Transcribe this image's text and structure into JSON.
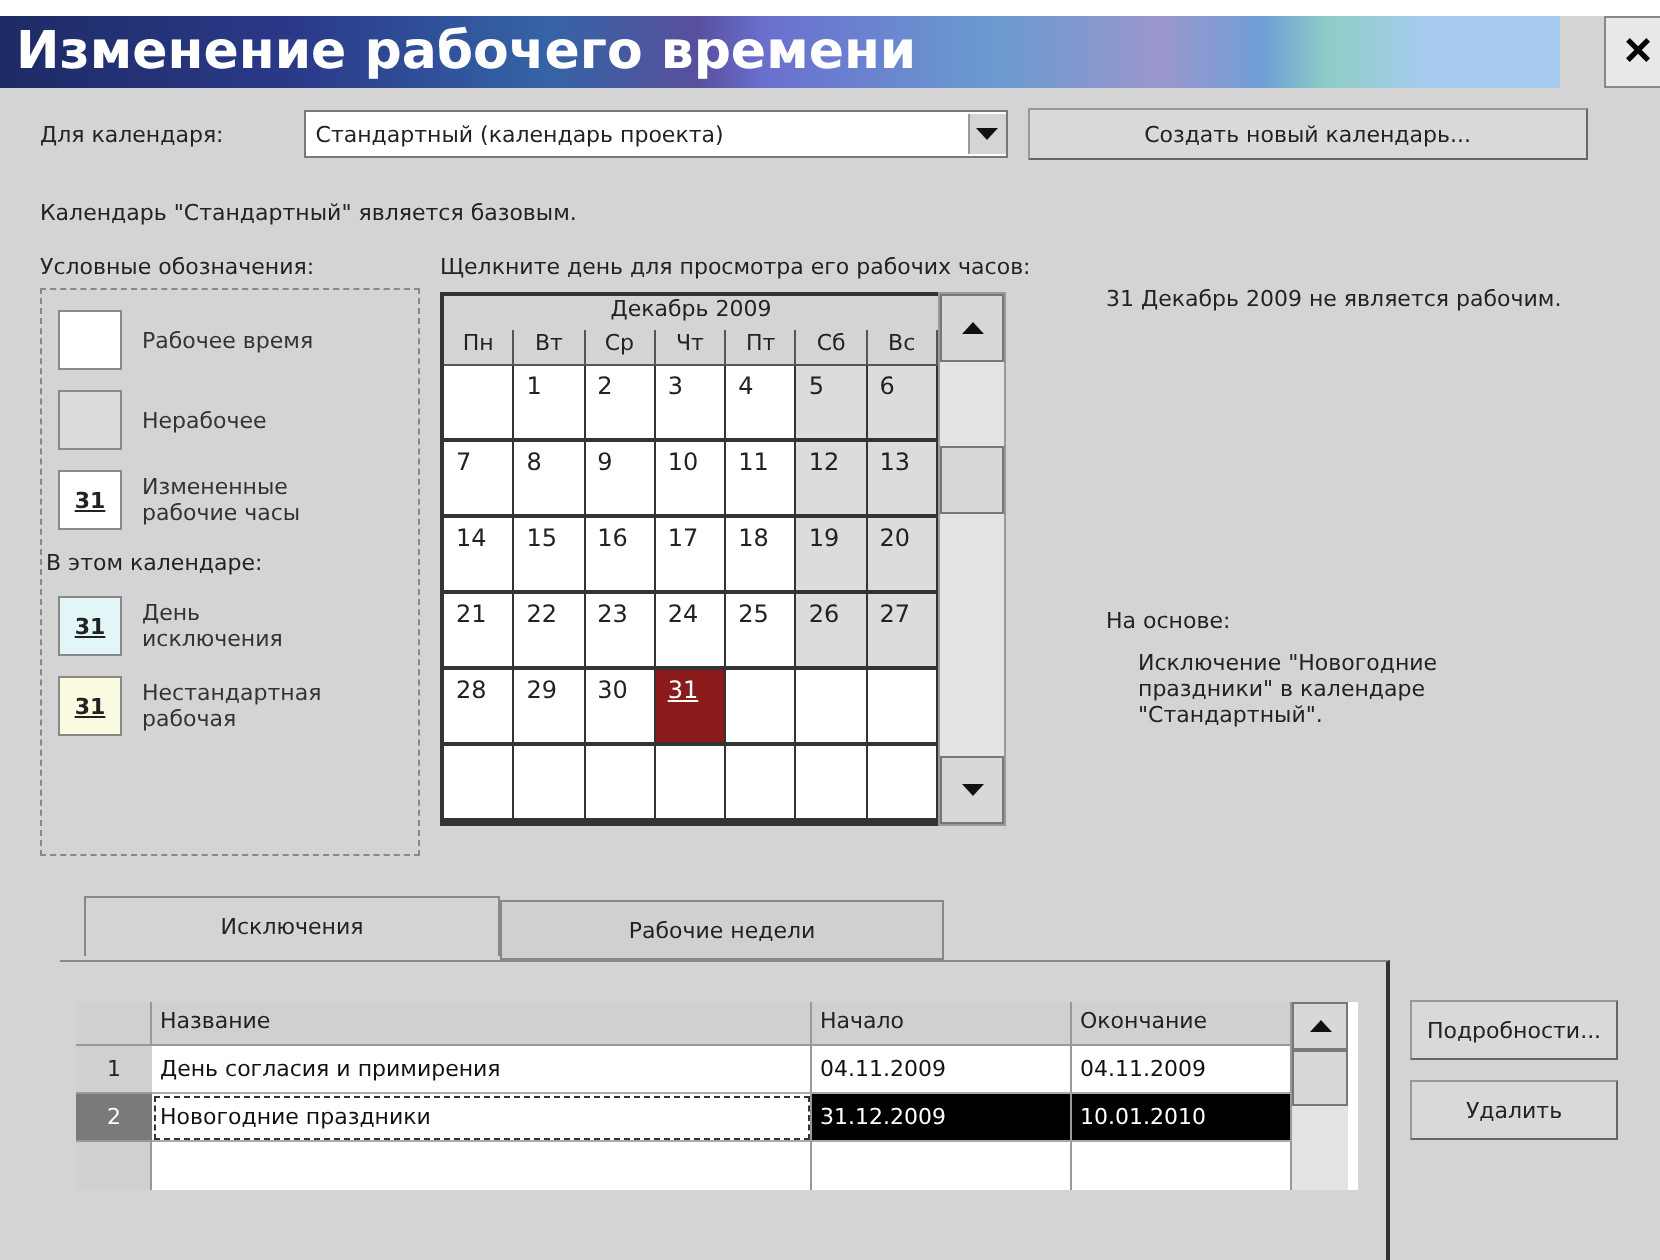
{
  "window": {
    "title": "Изменение рабочего времени",
    "close": "×"
  },
  "calendar_field": {
    "label": "Для календаря:",
    "value": "Стандартный (календарь проекта)"
  },
  "new_calendar_button": "Создать новый календарь...",
  "base_note": "Календарь \"Стандартный\" является базовым.",
  "legend": {
    "title": "Условные обозначения:",
    "items": [
      {
        "kind": "working",
        "label": "Рабочее время"
      },
      {
        "kind": "nonworking",
        "label": "Нерабочее"
      },
      {
        "kind": "changed",
        "sample": "31",
        "label": "Измененные рабочие часы"
      },
      {
        "kind": "heading",
        "label": "В этом календаре:"
      },
      {
        "kind": "exception",
        "sample": "31",
        "label": "День исключения"
      },
      {
        "kind": "nonstandard",
        "sample": "31",
        "label": "Нестандартная рабочая"
      }
    ]
  },
  "calendar": {
    "hint": "Щелкните день для просмотра его рабочих часов:",
    "month": "Декабрь 2009",
    "weekdays": [
      "Пн",
      "Вт",
      "Ср",
      "Чт",
      "Пт",
      "Сб",
      "Вс"
    ],
    "weeks": [
      [
        {
          "selected": false,
          "nonworking": false
        },
        {
          "day": "1",
          "selected": false,
          "nonworking": false
        },
        {
          "day": "2",
          "selected": false,
          "nonworking": false
        },
        {
          "day": "3",
          "selected": false,
          "nonworking": false
        },
        {
          "day": "4",
          "selected": false,
          "nonworking": false
        },
        {
          "day": "5",
          "selected": false,
          "nonworking": true
        },
        {
          "day": "6",
          "selected": false,
          "nonworking": true
        }
      ],
      [
        {
          "day": "7",
          "selected": false,
          "nonworking": false
        },
        {
          "day": "8",
          "selected": false,
          "nonworking": false
        },
        {
          "day": "9",
          "selected": false,
          "nonworking": false
        },
        {
          "day": "10",
          "selected": false,
          "nonworking": false
        },
        {
          "day": "11",
          "selected": false,
          "nonworking": false
        },
        {
          "day": "12",
          "selected": false,
          "nonworking": true
        },
        {
          "day": "13",
          "selected": false,
          "nonworking": true
        }
      ],
      [
        {
          "day": "14",
          "selected": false,
          "nonworking": false
        },
        {
          "day": "15",
          "selected": false,
          "nonworking": false
        },
        {
          "day": "16",
          "selected": false,
          "nonworking": false
        },
        {
          "day": "17",
          "selected": false,
          "nonworking": false
        },
        {
          "day": "18",
          "selected": false,
          "nonworking": false
        },
        {
          "day": "19",
          "selected": false,
          "nonworking": true
        },
        {
          "day": "20",
          "selected": false,
          "nonworking": true
        }
      ],
      [
        {
          "day": "21",
          "selected": false,
          "nonworking": false
        },
        {
          "day": "22",
          "selected": false,
          "nonworking": false
        },
        {
          "day": "23",
          "selected": false,
          "nonworking": false
        },
        {
          "day": "24",
          "selected": false,
          "nonworking": false
        },
        {
          "day": "25",
          "selected": false,
          "nonworking": false
        },
        {
          "day": "26",
          "selected": false,
          "nonworking": true
        },
        {
          "day": "27",
          "selected": false,
          "nonworking": true
        }
      ],
      [
        {
          "day": "28",
          "selected": false,
          "nonworking": false
        },
        {
          "day": "29",
          "selected": false,
          "nonworking": false
        },
        {
          "day": "30",
          "selected": false,
          "nonworking": false
        },
        {
          "day": "31",
          "selected": true,
          "nonworking": false
        },
        {
          "selected": false,
          "nonworking": false
        },
        {
          "selected": false,
          "nonworking": false
        },
        {
          "selected": false,
          "nonworking": false
        }
      ],
      [
        {
          "selected": false,
          "nonworking": false
        },
        {
          "selected": false,
          "nonworking": false
        },
        {
          "selected": false,
          "nonworking": false
        },
        {
          "selected": false,
          "nonworking": false
        },
        {
          "selected": false,
          "nonworking": false
        },
        {
          "selected": false,
          "nonworking": false
        },
        {
          "selected": false,
          "nonworking": false
        }
      ]
    ]
  },
  "day_info": {
    "status": "31 Декабрь 2009 не является рабочим.",
    "based_on_label": "На основе:",
    "based_on": "Исключение \"Новогодние праздники\" в календаре \"Стандартный\"."
  },
  "tabs": [
    {
      "label": "Исключения",
      "selected": true
    },
    {
      "label": "Рабочие недели",
      "selected": false
    }
  ],
  "table": {
    "columns": [
      "Название",
      "Начало",
      "Окончание"
    ],
    "rows": [
      {
        "number": "1",
        "name": "День согласия и примирения",
        "start": "04.11.2009",
        "end": "04.11.2009",
        "selected": false
      },
      {
        "number": "2",
        "name": "Новогодние праздники",
        "start": "31.12.2009",
        "end": "10.01.2010",
        "selected": true
      }
    ]
  },
  "side_buttons": [
    "Подробности...",
    "Удалить"
  ]
}
